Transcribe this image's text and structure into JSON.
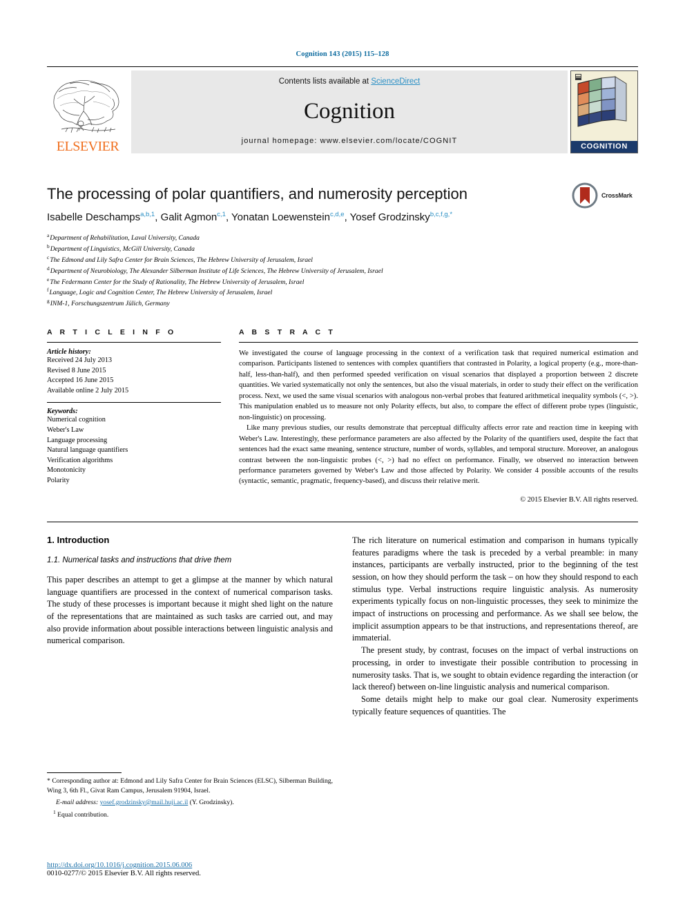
{
  "running_head": "Cognition 143 (2015) 115–128",
  "masthead": {
    "contents_prefix": "Contents lists available at ",
    "sciencedirect": "ScienceDirect",
    "journal_title": "Cognition",
    "homepage": "journal homepage: www.elsevier.com/locate/COGNIT",
    "publisher": "ELSEVIER",
    "badge_label": "COGNITION"
  },
  "title": "The processing of polar quantifiers, and numerosity perception",
  "crossmark_label": "CrossMark",
  "authors": [
    {
      "name": "Isabelle Deschamps",
      "sup": "a,b,1",
      "sep": ", "
    },
    {
      "name": "Galit Agmon",
      "sup": "c,1",
      "sep": ", "
    },
    {
      "name": "Yonatan Loewenstein",
      "sup": "c,d,e",
      "sep": ", "
    },
    {
      "name": "Yosef Grodzinsky",
      "sup": "b,c,f,g,*",
      "sep": ""
    }
  ],
  "affiliations": [
    {
      "marker": "a",
      "text": "Department of Rehabilitation, Laval University, Canada"
    },
    {
      "marker": "b",
      "text": "Department of Linguistics, McGill University, Canada"
    },
    {
      "marker": "c",
      "text": "The Edmond and Lily Safra Center for Brain Sciences, The Hebrew University of Jerusalem, Israel"
    },
    {
      "marker": "d",
      "text": "Department of Neurobiology, The Alexander Silberman Institute of Life Sciences, The Hebrew University of Jerusalem, Israel"
    },
    {
      "marker": "e",
      "text": "The Federmann Center for the Study of Rationality, The Hebrew University of Jerusalem, Israel"
    },
    {
      "marker": "f",
      "text": "Language, Logic and Cognition Center, The Hebrew University of Jerusalem, Israel"
    },
    {
      "marker": "g",
      "text": "INM-1, Forschungszentrum Jülich, Germany"
    }
  ],
  "article_info": {
    "heading": "A R T I C L E   I N F O",
    "history_label": "Article history:",
    "history": [
      "Received 24 July 2013",
      "Revised 8 June 2015",
      "Accepted 16 June 2015",
      "Available online 2 July 2015"
    ],
    "keywords_label": "Keywords:",
    "keywords": [
      "Numerical cognition",
      "Weber's Law",
      "Language processing",
      "Natural language quantifiers",
      "Verification algorithms",
      "Monotonicity",
      "Polarity"
    ]
  },
  "abstract": {
    "heading": "A B S T R A C T",
    "paragraphs": [
      "We investigated the course of language processing in the context of a verification task that required numerical estimation and comparison. Participants listened to sentences with complex quantifiers that contrasted in Polarity, a logical property (e.g., more-than-half, less-than-half), and then performed speeded verification on visual scenarios that displayed a proportion between 2 discrete quantities. We varied systematically not only the sentences, but also the visual materials, in order to study their effect on the verification process. Next, we used the same visual scenarios with analogous non-verbal probes that featured arithmetical inequality symbols (<, >). This manipulation enabled us to measure not only Polarity effects, but also, to compare the effect of different probe types (linguistic, non-linguistic) on processing.",
      "Like many previous studies, our results demonstrate that perceptual difficulty affects error rate and reaction time in keeping with Weber's Law. Interestingly, these performance parameters are also affected by the Polarity of the quantifiers used, despite the fact that sentences had the exact same meaning, sentence structure, number of words, syllables, and temporal structure. Moreover, an analogous contrast between the non-linguistic probes (<, >) had no effect on performance. Finally, we observed no interaction between performance parameters governed by Weber's Law and those affected by Polarity. We consider 4 possible accounts of the results (syntactic, semantic, pragmatic, frequency-based), and discuss their relative merit."
    ],
    "copyright": "© 2015 Elsevier B.V. All rights reserved."
  },
  "body": {
    "section_title": "1. Introduction",
    "subsection_title": "1.1. Numerical tasks and instructions that drive them",
    "left_paragraphs": [
      "This paper describes an attempt to get a glimpse at the manner by which natural language quantifiers are processed in the context of numerical comparison tasks. The study of these processes is important because it might shed light on the nature of the representations that are maintained as such tasks are carried out, and may also provide information about possible interactions between linguistic analysis and numerical comparison."
    ],
    "right_paragraphs": [
      "The rich literature on numerical estimation and comparison in humans typically features paradigms where the task is preceded by a verbal preamble: in many instances, participants are verbally instructed, prior to the beginning of the test session, on how they should perform the task – on how they should respond to each stimulus type. Verbal instructions require linguistic analysis. As numerosity experiments typically focus on non-linguistic processes, they seek to minimize the impact of instructions on processing and performance. As we shall see below, the implicit assumption appears to be that instructions, and representations thereof, are immaterial.",
      "The present study, by contrast, focuses on the impact of verbal instructions on processing, in order to investigate their possible contribution to processing in numerosity tasks. That is, we sought to obtain evidence regarding the interaction (or lack thereof) between on-line linguistic analysis and numerical comparison.",
      "Some details might help to make our goal clear. Numerosity experiments typically feature sequences of quantities. The"
    ]
  },
  "footnotes": {
    "corresponding": "* Corresponding author at: Edmond and Lily Safra Center for Brain Sciences (ELSC), Silberman Building, Wing 3, 6th Fl., Givat Ram Campus, Jerusalem 91904, Israel.",
    "email_label": "E-mail address:",
    "email": "yosef.grodzinsky@mail.huji.ac.il",
    "email_suffix": "(Y. Grodzinsky).",
    "equal_marker": "1",
    "equal_text": "Equal contribution."
  },
  "doi": {
    "url": "http://dx.doi.org/10.1016/j.cognition.2015.06.006",
    "issn_line": "0010-0277/© 2015 Elsevier B.V. All rights reserved."
  },
  "colors": {
    "link": "#1a6fa8",
    "running_head": "#0b6a9e",
    "elsevier_orange": "#f06f1e",
    "band_gray": "#e8e8e8",
    "badge_blue": "#1b3a6b"
  }
}
